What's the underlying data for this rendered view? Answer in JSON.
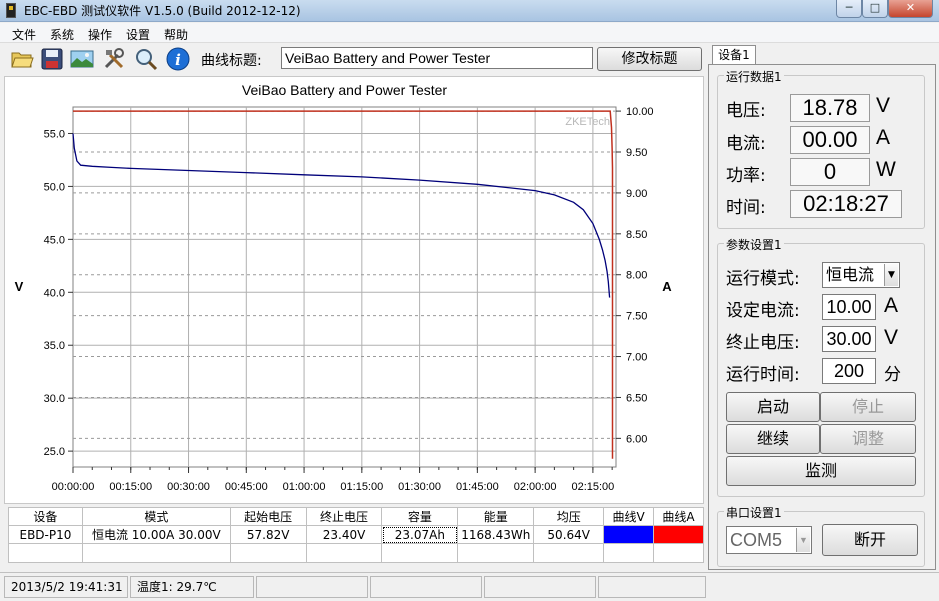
{
  "window": {
    "title": "EBC-EBD 测试仪软件 V1.5.0 (Build 2012-12-12)",
    "min_symbol": "─",
    "max_symbol": "□",
    "close_symbol": "✕"
  },
  "menu": [
    "文件",
    "系统",
    "操作",
    "设置",
    "帮助"
  ],
  "toolbar": {
    "curve_title_label": "曲线标题:",
    "curve_title_value": "VeiBao Battery and Power Tester",
    "modify_title_button": "修改标题",
    "icons": [
      "folder-open-icon",
      "save-icon",
      "image-icon",
      "tools-icon",
      "zoom-icon",
      "info-icon"
    ]
  },
  "chart_data": {
    "type": "line",
    "title": "VeiBao Battery and Power Tester",
    "watermark": "ZKETech",
    "ylabel_left": "V",
    "ylabel_right": "A",
    "xlim_seconds": [
      0,
      8460
    ],
    "x_tick_labels": [
      "00:00:00",
      "00:15:00",
      "00:30:00",
      "00:45:00",
      "01:00:00",
      "01:15:00",
      "01:30:00",
      "01:45:00",
      "02:00:00",
      "02:15:00"
    ],
    "x_tick_seconds": [
      0,
      900,
      1800,
      2700,
      3600,
      4500,
      5400,
      6300,
      7200,
      8100
    ],
    "ylim_left": [
      23.5,
      57.5
    ],
    "yticks_left": [
      25.0,
      30.0,
      35.0,
      40.0,
      45.0,
      50.0,
      55.0
    ],
    "y_tick_labels_left": [
      "25.0",
      "30.0",
      "35.0",
      "40.0",
      "45.0",
      "50.0",
      "55.0"
    ],
    "ylim_right": [
      5.65,
      10.05
    ],
    "yticks_right": [
      6.0,
      6.5,
      7.0,
      7.5,
      8.0,
      8.5,
      9.0,
      9.5,
      10.0
    ],
    "y_tick_labels_right": [
      "6.00",
      "6.50",
      "7.00",
      "7.50",
      "8.00",
      "8.50",
      "9.00",
      "9.50",
      "10.00"
    ],
    "grid": true,
    "series": [
      {
        "axis": "left",
        "color": "#00007a",
        "x": [
          0,
          20,
          60,
          120,
          300,
          600,
          900,
          1800,
          2700,
          3600,
          4500,
          5400,
          6300,
          7200,
          7500,
          7800,
          7950,
          8100,
          8200,
          8250,
          8290,
          8320,
          8340,
          8350,
          8360
        ],
        "y": [
          55.0,
          53.6,
          52.4,
          52.0,
          51.9,
          51.8,
          51.7,
          51.5,
          51.3,
          51.1,
          50.9,
          50.6,
          50.2,
          49.6,
          49.2,
          48.5,
          47.8,
          46.5,
          45.0,
          44.0,
          43.0,
          42.0,
          41.0,
          40.3,
          39.5
        ]
      },
      {
        "axis": "right",
        "color": "#c0301e",
        "x": [
          0,
          8370,
          8390,
          8400,
          8405,
          8405
        ],
        "y": [
          10.0,
          10.0,
          9.8,
          9.55,
          9.3,
          5.75
        ]
      }
    ]
  },
  "table": {
    "headers": [
      "设备",
      "模式",
      "起始电压",
      "终止电压",
      "容量",
      "能量",
      "均压",
      "曲线V",
      "曲线A"
    ],
    "rows": [
      [
        "EBD-P10",
        "恒电流  10.00A  30.00V",
        "57.82V",
        "23.40V",
        "23.07Ah",
        "1168.43Wh",
        "50.64V"
      ]
    ],
    "curve_v_color": "#0000ff",
    "curve_a_color": "#ff0000"
  },
  "status": {
    "datetime": "2013/5/2 19:41:31",
    "temperature": "温度1: 29.7℃"
  },
  "panel": {
    "tab": "设备1",
    "run_data": {
      "group_label": "运行数据1",
      "voltage_label": "电压:",
      "voltage_value": "18.78",
      "voltage_unit": "V",
      "current_label": "电流:",
      "current_value": "00.00",
      "current_unit": "A",
      "power_label": "功率:",
      "power_value": "0",
      "power_unit": "W",
      "time_label": "时间:",
      "time_value": "02:18:27"
    },
    "params": {
      "group_label": "参数设置1",
      "mode_label": "运行模式:",
      "mode_value": "恒电流",
      "set_current_label": "设定电流:",
      "set_current_value": "10.00",
      "set_current_unit": "A",
      "end_voltage_label": "终止电压:",
      "end_voltage_value": "30.00",
      "end_voltage_unit": "V",
      "run_time_label": "运行时间:",
      "run_time_value": "200",
      "run_time_unit": "分"
    },
    "buttons": {
      "start": "启动",
      "stop": "停止",
      "continue": "继续",
      "adjust": "调整",
      "monitor": "监测"
    },
    "serial": {
      "group_label": "串口设置1",
      "port_value": "COM5",
      "disconnect": "断开"
    }
  }
}
